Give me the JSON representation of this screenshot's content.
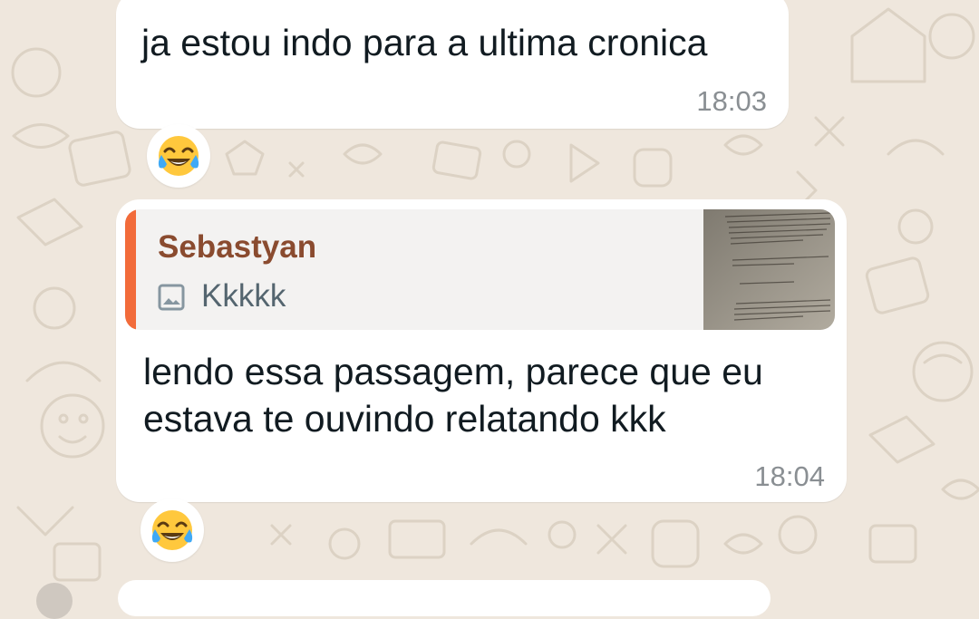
{
  "theme": {
    "wallpaper": "#efe7dd",
    "bubble": "#ffffff",
    "quote_accent": "#f26b3a",
    "quote_author_color": "#8a4b2f"
  },
  "messages": [
    {
      "text": "ja estou indo para a ultima cronica",
      "time": "18:03",
      "reaction": "face-with-tears-of-joy-emoji"
    },
    {
      "reply": {
        "author": "Sebastyan",
        "icon": "image-icon",
        "text": "Kkkkk"
      },
      "text": "lendo essa passagem, parece que eu estava te ouvindo relatando kkk",
      "time": "18:04",
      "reaction": "face-with-tears-of-joy-emoji"
    }
  ]
}
